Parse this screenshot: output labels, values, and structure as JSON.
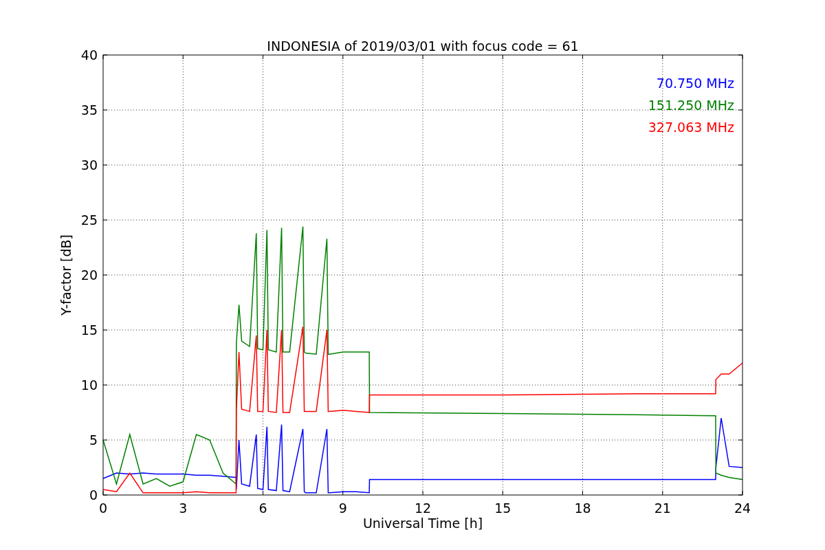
{
  "figure": {
    "chart_data": {
      "type": "line",
      "title": "INDONESIA of 2019/03/01 with focus code = 61",
      "xlabel": "Universal Time [h]",
      "ylabel": "Y-factor [dB]",
      "x": [
        0,
        0.5,
        1,
        1.5,
        2,
        2.5,
        3,
        3.5,
        4,
        4.5,
        4.99,
        5,
        5.1,
        5.2,
        5.5,
        5.75,
        5.8,
        6,
        6.15,
        6.2,
        6.5,
        6.7,
        6.75,
        7,
        7.5,
        7.55,
        7.6,
        8,
        8.4,
        8.45,
        8.5,
        9,
        9.5,
        9.99,
        10,
        15,
        20,
        22.99,
        23,
        23.2,
        23.5,
        24
      ],
      "series": [
        {
          "name": "70.750 MHz",
          "color": "#0000ff",
          "values": [
            1.5,
            2,
            1.9,
            2,
            1.9,
            1.9,
            1.9,
            1.8,
            1.8,
            1.7,
            1.6,
            0.5,
            5,
            1,
            0.8,
            5.5,
            0.6,
            0.5,
            6.2,
            0.5,
            0.4,
            6.4,
            0.4,
            0.3,
            6,
            0.3,
            0.2,
            0.2,
            6,
            0.2,
            0.2,
            0.3,
            0.3,
            0.2,
            1.4,
            1.4,
            1.4,
            1.4,
            2.5,
            7,
            2.6,
            2.5
          ]
        },
        {
          "name": "151.250 MHz",
          "color": "#008000",
          "values": [
            5,
            1,
            5.5,
            1,
            1.5,
            0.8,
            1.2,
            5.5,
            5,
            2,
            1,
            13.8,
            17.3,
            14,
            13.5,
            23.8,
            13.3,
            13.2,
            24.1,
            13.2,
            13,
            24.3,
            13,
            13,
            24.4,
            13,
            12.9,
            12.8,
            23.3,
            12.8,
            12.8,
            13,
            13,
            13,
            7.5,
            7.4,
            7.3,
            7.2,
            2,
            1.8,
            1.6,
            1.4
          ]
        },
        {
          "name": "327.063 MHz",
          "color": "#ff0000",
          "values": [
            0.5,
            0.3,
            2,
            0.2,
            0.2,
            0.2,
            0.2,
            0.3,
            0.2,
            0.2,
            0.2,
            7.7,
            13,
            7.8,
            7.6,
            14.5,
            7.6,
            7.6,
            15,
            7.6,
            7.5,
            15,
            7.5,
            7.5,
            15.3,
            7.6,
            7.6,
            7.6,
            15,
            7.6,
            7.6,
            7.7,
            7.6,
            7.5,
            9.1,
            9.1,
            9.2,
            9.2,
            10.5,
            11,
            11,
            12
          ]
        }
      ],
      "grid": true,
      "xlim": [
        0,
        24
      ],
      "ylim": [
        0,
        40
      ],
      "xticks": [
        0,
        3,
        6,
        9,
        12,
        15,
        18,
        21,
        24
      ],
      "yticks": [
        0,
        5,
        10,
        15,
        20,
        25,
        30,
        35,
        40
      ]
    }
  }
}
